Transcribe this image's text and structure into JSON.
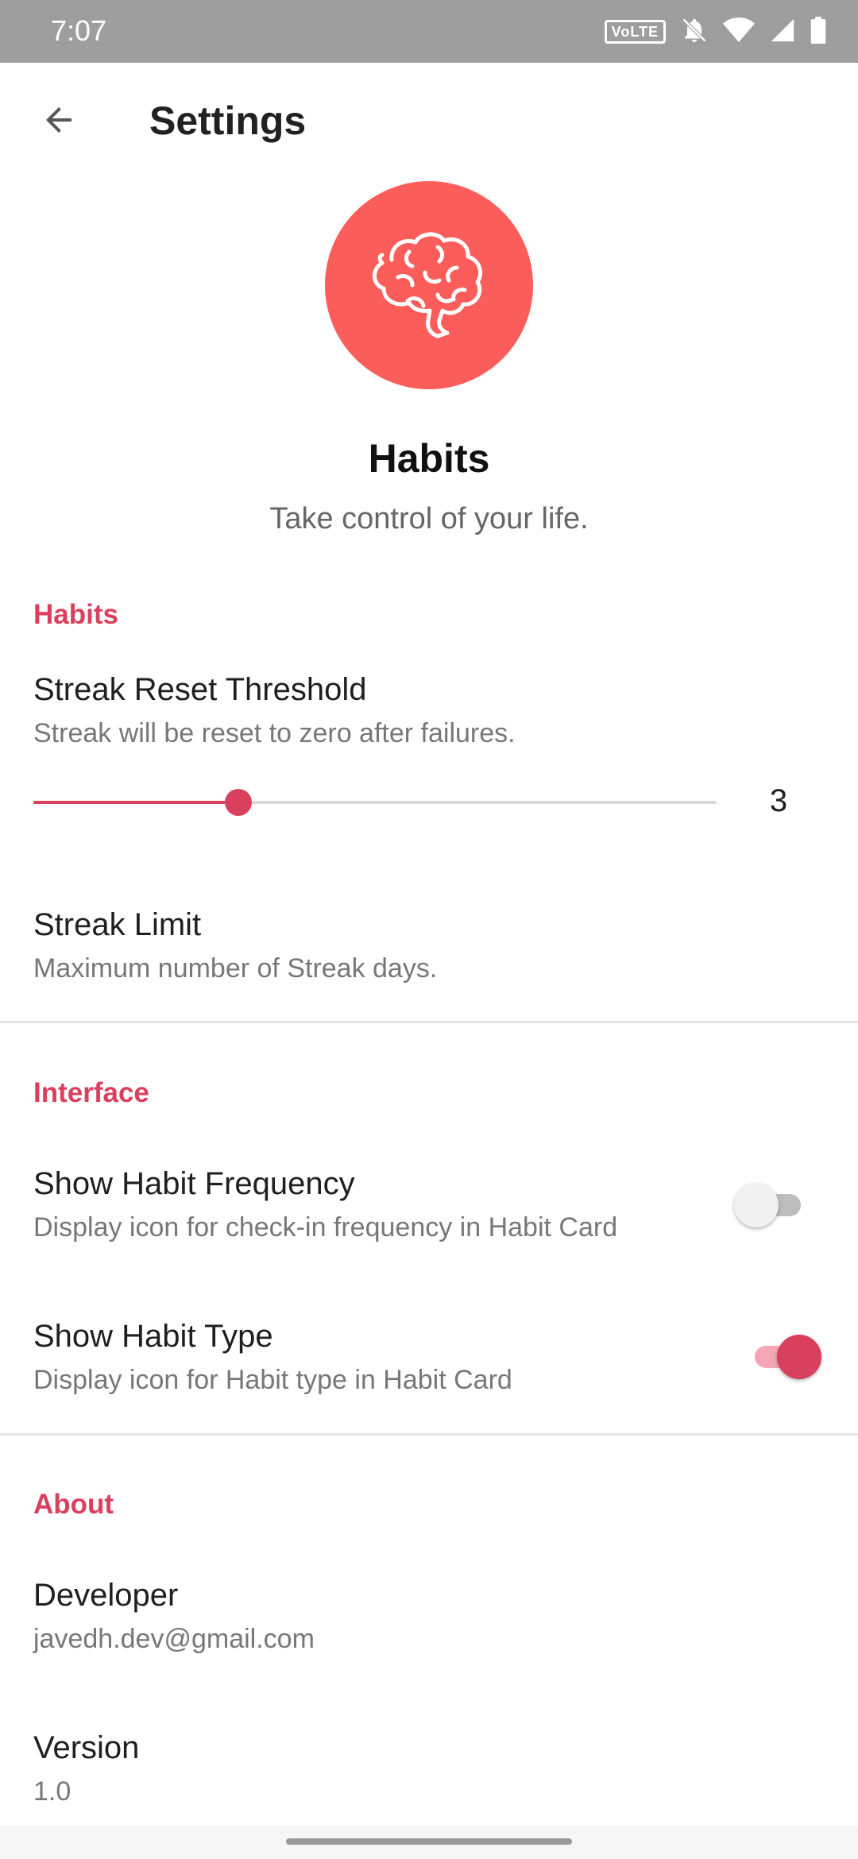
{
  "status_bar": {
    "time": "7:07",
    "volte": "VoLTE"
  },
  "app_bar": {
    "title": "Settings"
  },
  "header": {
    "app_name": "Habits",
    "tagline": "Take control of your life."
  },
  "colors": {
    "accent": "#d9405e",
    "logo_bg": "#fb5d5a",
    "status_bar_bg": "#9e9e9e"
  },
  "sections": {
    "habits": {
      "header": "Habits",
      "streak_reset": {
        "title": "Streak Reset Threshold",
        "summary": "Streak will be reset to zero after failures.",
        "value": "3",
        "slider_fraction": 0.3
      },
      "streak_limit": {
        "title": "Streak Limit",
        "summary": "Maximum number of Streak days."
      }
    },
    "interface": {
      "header": "Interface",
      "show_frequency": {
        "title": "Show Habit Frequency",
        "summary": "Display icon for check-in frequency in Habit Card",
        "enabled": false
      },
      "show_type": {
        "title": "Show Habit Type",
        "summary": "Display icon for Habit type in Habit Card",
        "enabled": true
      }
    },
    "about": {
      "header": "About",
      "developer": {
        "title": "Developer",
        "summary": "javedh.dev@gmail.com"
      },
      "version": {
        "title": "Version",
        "summary": "1.0"
      }
    }
  },
  "icons": {
    "back": "arrow-left-icon",
    "logo": "brain-icon",
    "status": [
      "volte-icon",
      "notifications-off-icon",
      "wifi-icon",
      "signal-icon",
      "battery-icon"
    ]
  }
}
